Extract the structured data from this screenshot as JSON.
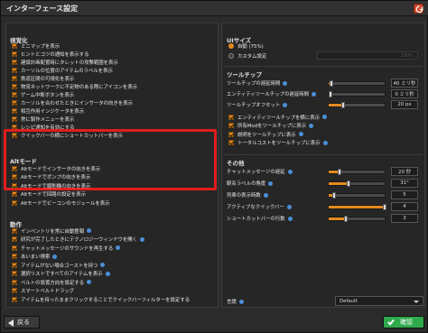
{
  "window": {
    "title": "インターフェース設定"
  },
  "left": {
    "visual_heading": "視覚化",
    "visual_items": [
      "ミニマップを表示",
      "ヒントとコツの通知を表示する",
      "建設計画配置時にタレットの攻撃範囲を表示",
      "カーソルの位置のアイテムのラベルを表示",
      "鉄道区間の可視化を表示",
      "物流ネットワークに不足物のある際にアイコンを表示",
      "ゲーム中断ボタンを表示",
      "カーソルを合わせたときにインサータの向きを表示",
      "相互作用インジケータを表示",
      "常に製作メニューを表示",
      "レシピ通知を有効にする",
      "クイックバーの横にショートカットバーを表示"
    ],
    "alt_heading": "Altモード",
    "alt_items": [
      "Altモードでインサータの向きを表示",
      "Altモードでポンプの向きを表示",
      "Altモードで掘削機の向きを表示",
      "Altモードで回路の設定を表示",
      "Altモードでビーコンのモジュールを表示"
    ],
    "action_heading": "動作",
    "action_items": [
      "インベントリを常に自動整頓",
      "研究が完了したときにテクノロジーウィンドウを開く",
      "チャットメッセージのサウンドを再生する",
      "あいまい検索",
      "アイテムがない場合ゴーストを持つ",
      "選択リストですべてのアイテムを表示",
      "ベルトの設置方向を設定する",
      "スマートベルトドラッグ",
      "アイテムを持ったままクリックすることでクイックバーフィルターを設定する"
    ]
  },
  "right": {
    "ui_heading": "UIサイズ",
    "ui_auto": "自動 (75%)",
    "ui_custom": "カスタム設定",
    "ui_custom_value": "100%",
    "tooltip_heading": "ツールチップ",
    "tooltip_sliders": [
      {
        "label": "ツールチップの遅延時間",
        "value": "40 ミリ秒",
        "level": 0.05
      },
      {
        "label": "エンティティツールチップの遅延時間",
        "value": "0 ミリ秒",
        "level": 0.0
      },
      {
        "label": "ツールチップオフセット",
        "value": "20 px",
        "level": 0.25
      }
    ],
    "tooltip_checks": [
      "エンティティツールチップを横に表示",
      "所有Modをツールチップに表示",
      "説明をツールチップに表示",
      "トータルコストをツールチップに表示"
    ],
    "other_heading": "その他",
    "other_sliders": [
      {
        "label": "チャットメッセージの遅延",
        "value": "20 秒",
        "level": 0.2
      },
      {
        "label": "駅名ラベルの角度",
        "value": "31°",
        "level": 0.35
      },
      {
        "label": "列車の表示時数",
        "value": "5",
        "level": 0.1
      },
      {
        "label": "アクティブなクイックバー",
        "value": "4",
        "level": 1.0
      },
      {
        "label": "ショートカットバーの行数",
        "value": "3",
        "level": 0.3
      }
    ],
    "language_label": "言語",
    "language_value": "Default"
  },
  "footer": {
    "back_label": "戻る",
    "confirm_label": "確認"
  },
  "colors": {
    "accent": "#e58a1f",
    "highlight": "#e21d1d",
    "confirm": "#2fa94c",
    "info": "#4a8fd8"
  }
}
